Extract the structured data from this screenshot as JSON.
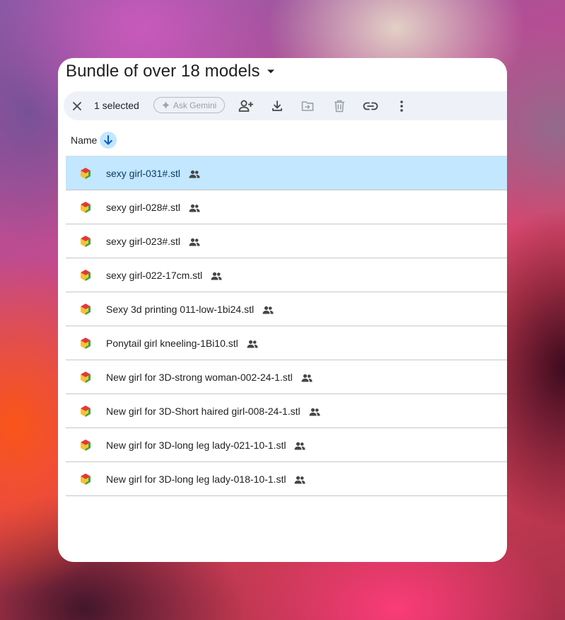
{
  "folder": {
    "title": "Bundle of over 18 models"
  },
  "toolbar": {
    "selected_count": "1 selected",
    "ask_gemini_label": "Ask Gemini"
  },
  "list_header": {
    "name_label": "Name",
    "sort": "descending"
  },
  "files": [
    {
      "name": "sexy girl-031#.stl",
      "shared": true,
      "selected": true
    },
    {
      "name": "sexy girl-028#.stl",
      "shared": true,
      "selected": false
    },
    {
      "name": "sexy girl-023#.stl",
      "shared": true,
      "selected": false
    },
    {
      "name": "sexy girl-022-17cm.stl",
      "shared": true,
      "selected": false
    },
    {
      "name": "Sexy 3d printing 011-low-1bi24.stl",
      "shared": true,
      "selected": false
    },
    {
      "name": "Ponytail girl kneeling-1Bi10.stl",
      "shared": true,
      "selected": false
    },
    {
      "name": "New girl for 3D-strong woman-002-24-1.stl",
      "shared": true,
      "selected": false
    },
    {
      "name": "New girl for 3D-Short haired girl-008-24-1.stl",
      "shared": true,
      "selected": false
    },
    {
      "name": "New girl for 3D-long leg lady-021-10-1.stl",
      "shared": true,
      "selected": false
    },
    {
      "name": "New girl for 3D-long leg lady-018-10-1.stl",
      "shared": true,
      "selected": false
    }
  ],
  "colors": {
    "selection": "#c2e7ff",
    "toolbar_bg": "#eef1f7",
    "sort_button": "#c2e7ff"
  }
}
